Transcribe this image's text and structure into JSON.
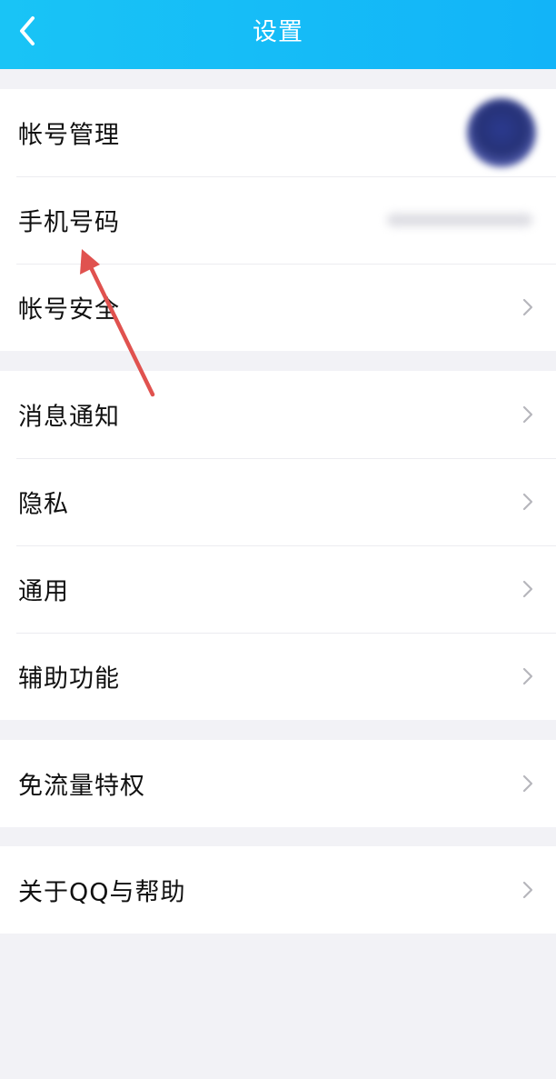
{
  "header": {
    "title": "设置",
    "back_icon": "chevron-left-icon",
    "background_color": "#16bdf7"
  },
  "groups": [
    {
      "items": [
        {
          "label": "帐号管理",
          "trailing": "avatar"
        },
        {
          "label": "手机号码",
          "trailing": "value"
        },
        {
          "label": "帐号安全",
          "trailing": "chevron-right-icon"
        }
      ]
    },
    {
      "items": [
        {
          "label": "消息通知",
          "trailing": "chevron-right-icon"
        },
        {
          "label": "隐私",
          "trailing": "chevron-right-icon"
        },
        {
          "label": "通用",
          "trailing": "chevron-right-icon"
        },
        {
          "label": "辅助功能",
          "trailing": "chevron-right-icon"
        }
      ]
    },
    {
      "items": [
        {
          "label": "免流量特权",
          "trailing": "chevron-right-icon"
        }
      ]
    },
    {
      "items": [
        {
          "label": "关于QQ与帮助",
          "trailing": "chevron-right-icon"
        }
      ]
    }
  ],
  "annotation": {
    "type": "arrow",
    "color": "#e0524f",
    "points_to": "手机号码"
  }
}
